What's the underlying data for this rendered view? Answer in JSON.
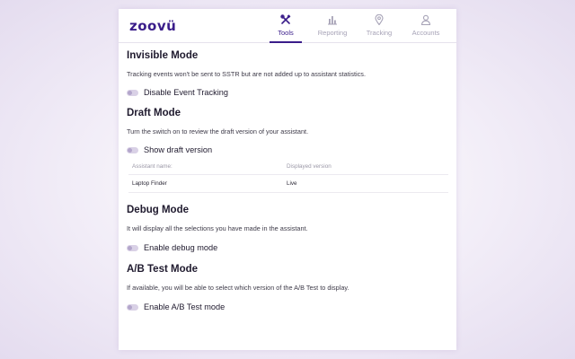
{
  "app": {
    "logo": "zoovü",
    "brand_color": "#3a1d8a"
  },
  "nav": {
    "items": [
      {
        "label": "Tools",
        "icon": "tools-icon",
        "active": true
      },
      {
        "label": "Reporting",
        "icon": "bar-chart-icon",
        "active": false
      },
      {
        "label": "Tracking",
        "icon": "location-pin-icon",
        "active": false
      },
      {
        "label": "Accounts",
        "icon": "user-icon",
        "active": false
      }
    ]
  },
  "invisible": {
    "title": "Invisible Mode",
    "description": "Tracking events won't be sent to SSTR but are not added up to assistant statistics.",
    "toggle_label": "Disable Event Tracking",
    "toggle_on": false
  },
  "draft": {
    "title": "Draft Mode",
    "description": "Turn the switch on to review the draft version of your assistant.",
    "toggle_label": "Show draft version",
    "toggle_on": false,
    "table": {
      "headers": [
        "Assistant name:",
        "Displayed version"
      ],
      "rows": [
        [
          "Laptop Finder",
          "Live"
        ]
      ]
    }
  },
  "debug": {
    "title": "Debug Mode",
    "description": "It will display all the selections you have made in the assistant.",
    "toggle_label": "Enable debug mode",
    "toggle_on": false
  },
  "abtest": {
    "title": "A/B Test Mode",
    "description": "If available, you will be able to select which version of the A/B Test to display.",
    "toggle_label": "Enable A/B Test mode",
    "toggle_on": false
  }
}
